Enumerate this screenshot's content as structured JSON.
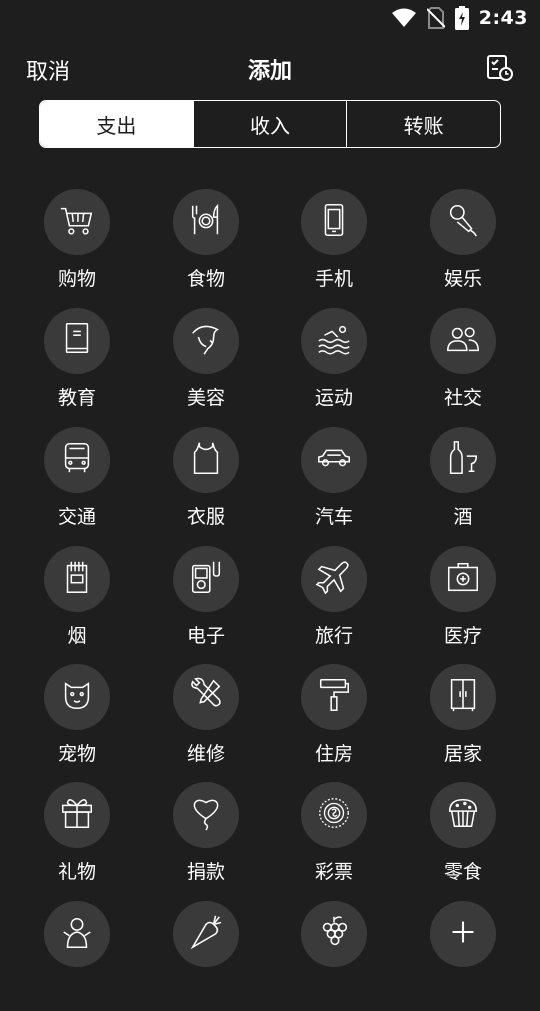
{
  "status_bar": {
    "time": "2:43",
    "icons": [
      "wifi-icon",
      "no-sim-icon",
      "battery-charging-icon"
    ]
  },
  "header": {
    "cancel_label": "取消",
    "title": "添加",
    "history_icon": "calendar-check-icon"
  },
  "tabs": [
    {
      "label": "支出",
      "active": true
    },
    {
      "label": "收入",
      "active": false
    },
    {
      "label": "转账",
      "active": false
    }
  ],
  "categories": [
    {
      "label": "购物",
      "icon": "cart-icon"
    },
    {
      "label": "食物",
      "icon": "utensils-icon"
    },
    {
      "label": "手机",
      "icon": "phone-icon"
    },
    {
      "label": "娱乐",
      "icon": "microphone-icon"
    },
    {
      "label": "教育",
      "icon": "book-icon"
    },
    {
      "label": "美容",
      "icon": "face-icon"
    },
    {
      "label": "运动",
      "icon": "swimming-icon"
    },
    {
      "label": "社交",
      "icon": "people-icon"
    },
    {
      "label": "交通",
      "icon": "bus-icon"
    },
    {
      "label": "衣服",
      "icon": "tank-top-icon"
    },
    {
      "label": "汽车",
      "icon": "car-icon"
    },
    {
      "label": "酒",
      "icon": "wine-icon"
    },
    {
      "label": "烟",
      "icon": "cigarette-pack-icon"
    },
    {
      "label": "电子",
      "icon": "music-player-icon"
    },
    {
      "label": "旅行",
      "icon": "airplane-icon"
    },
    {
      "label": "医疗",
      "icon": "first-aid-kit-icon"
    },
    {
      "label": "宠物",
      "icon": "pet-icon"
    },
    {
      "label": "维修",
      "icon": "tools-icon"
    },
    {
      "label": "住房",
      "icon": "paint-roller-icon"
    },
    {
      "label": "居家",
      "icon": "wardrobe-icon"
    },
    {
      "label": "礼物",
      "icon": "gift-icon"
    },
    {
      "label": "捐款",
      "icon": "heart-balloon-icon"
    },
    {
      "label": "彩票",
      "icon": "lottery-ball-icon"
    },
    {
      "label": "零食",
      "icon": "cupcake-icon"
    },
    {
      "label": "",
      "icon": "doll-icon"
    },
    {
      "label": "",
      "icon": "carrot-icon"
    },
    {
      "label": "",
      "icon": "grapes-icon"
    },
    {
      "label": "",
      "icon": "plus-icon"
    }
  ]
}
